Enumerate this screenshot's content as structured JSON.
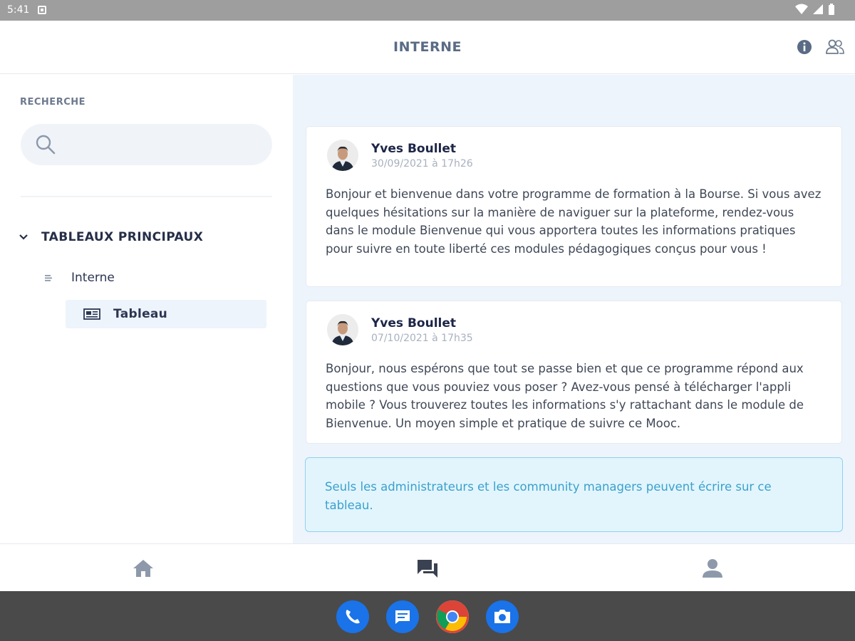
{
  "status_bar": {
    "time": "5:41"
  },
  "header": {
    "title": "INTERNE"
  },
  "sidebar": {
    "search_label": "RECHERCHE",
    "search_value": "",
    "section_title": "TABLEAUX PRINCIPAUX",
    "tree_item": "Interne",
    "board_item": "Tableau"
  },
  "posts": [
    {
      "author": "Yves Boullet",
      "date": "30/09/2021 à 17h26",
      "body": "Bonjour et bienvenue dans votre programme de formation à la Bourse. Si vous avez quelques hésitations sur la manière de naviguer sur la plateforme, rendez-vous dans le module Bienvenue qui vous apportera toutes les informations pratiques pour suivre en toute liberté ces modules pédagogiques conçus pour vous !"
    },
    {
      "author": "Yves Boullet",
      "date": "07/10/2021 à 17h35",
      "body": "Bonjour, nous espérons que tout se passe bien et que ce programme répond aux questions que vous pouviez vous poser ? Avez-vous pensé à télécharger l'appli mobile ? Vous trouverez toutes les informations s'y rattachant dans le module de Bienvenue. Un moyen simple et pratique de suivre ce Mooc."
    }
  ],
  "notice": {
    "text": "Seuls les administrateurs et les community managers peuvent écrire sur ce tableau."
  },
  "bottom_nav": {
    "tabs": [
      "home-icon",
      "chat-icon",
      "profile-icon"
    ],
    "active": "chat-icon"
  },
  "dock": {
    "apps": [
      "phone-icon",
      "messages-icon",
      "chrome-icon",
      "camera-icon"
    ]
  },
  "colors": {
    "accent": "#5a6b85",
    "feed_bg": "#eef4fb",
    "notice_text": "#3ba0cc",
    "notice_border": "#8fd2ee"
  }
}
